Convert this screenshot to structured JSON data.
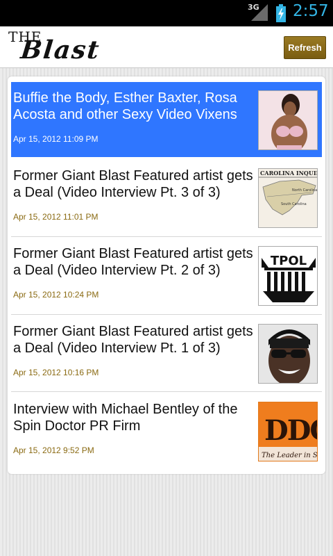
{
  "status_bar": {
    "network": "3G",
    "time": "2:57"
  },
  "header": {
    "logo_the": "THE",
    "logo_blast": "Blast",
    "refresh_label": "Refresh"
  },
  "articles": [
    {
      "title": "Buffie the Body, Esther Baxter, Rosa Acosta and other Sexy Video Vixens",
      "date": "Apr 15, 2012 11:09 PM"
    },
    {
      "title": "Former Giant Blast Featured artist gets a Deal (Video Interview Pt. 3 of 3)",
      "date": "Apr 15, 2012 11:01 PM",
      "thumb_text": "CAROLINA INQUIRE",
      "thumb_map_labels": [
        "North Carolina",
        "South Carolina"
      ]
    },
    {
      "title": "Former Giant Blast Featured artist gets a Deal (Video Interview Pt. 2 of 3)",
      "date": "Apr 15, 2012 10:24 PM",
      "thumb_text": "TPOL"
    },
    {
      "title": "Former Giant Blast Featured artist gets a Deal (Video Interview Pt. 1 of 3)",
      "date": "Apr 15, 2012 10:16 PM"
    },
    {
      "title": "Interview with Michael Bentley of the Spin Doctor PR Firm",
      "date": "Apr 15, 2012 9:52 PM",
      "thumb_text": "DDC",
      "thumb_caption": "The Leader in S"
    }
  ],
  "colors": {
    "selected": "#2f76ff",
    "date": "#8a6a12",
    "refresh": "#8a6c1a",
    "clock": "#33b5e5"
  }
}
